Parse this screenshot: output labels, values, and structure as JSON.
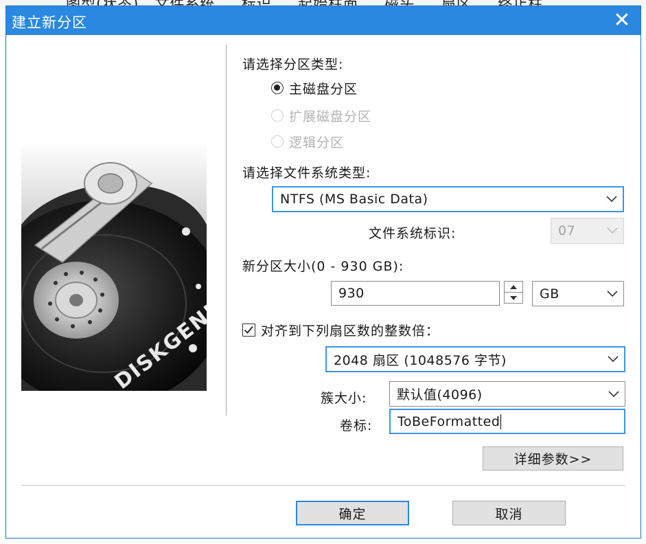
{
  "background_text": "图型(状态)   文件系统     标识     起始柱面     磁头     扇区     终止柱",
  "dialog": {
    "title": "建立新分区",
    "close_label": "✕"
  },
  "partition_type": {
    "label": "请选择分区类型:",
    "options": [
      {
        "label": "主磁盘分区",
        "selected": true,
        "enabled": true
      },
      {
        "label": "扩展磁盘分区",
        "selected": false,
        "enabled": false
      },
      {
        "label": "逻辑分区",
        "selected": false,
        "enabled": false
      }
    ]
  },
  "filesystem": {
    "label": "请选择文件系统类型:",
    "selected": "NTFS (MS Basic Data)",
    "id_label": "文件系统标识:",
    "id_value": "07"
  },
  "size": {
    "label": "新分区大小(0 - 930 GB):",
    "value": "930",
    "unit": "GB"
  },
  "align": {
    "checked": true,
    "label": "对齐到下列扇区数的整数倍：",
    "selected": "2048 扇区 (1048576 字节)"
  },
  "cluster": {
    "label": "簇大小:",
    "selected": "默认值(4096)"
  },
  "volume": {
    "label": "卷标:",
    "value": "ToBeFormatted"
  },
  "buttons": {
    "details": "详细参数>>",
    "ok": "确定",
    "cancel": "取消"
  },
  "image": {
    "brand_text": "DISKGENIUS"
  },
  "colors": {
    "titlebar": "#2b88e0",
    "focus_border": "#3b94e8",
    "button_face": "#e1e1e1",
    "disabled_text": "#b3b3b3"
  }
}
